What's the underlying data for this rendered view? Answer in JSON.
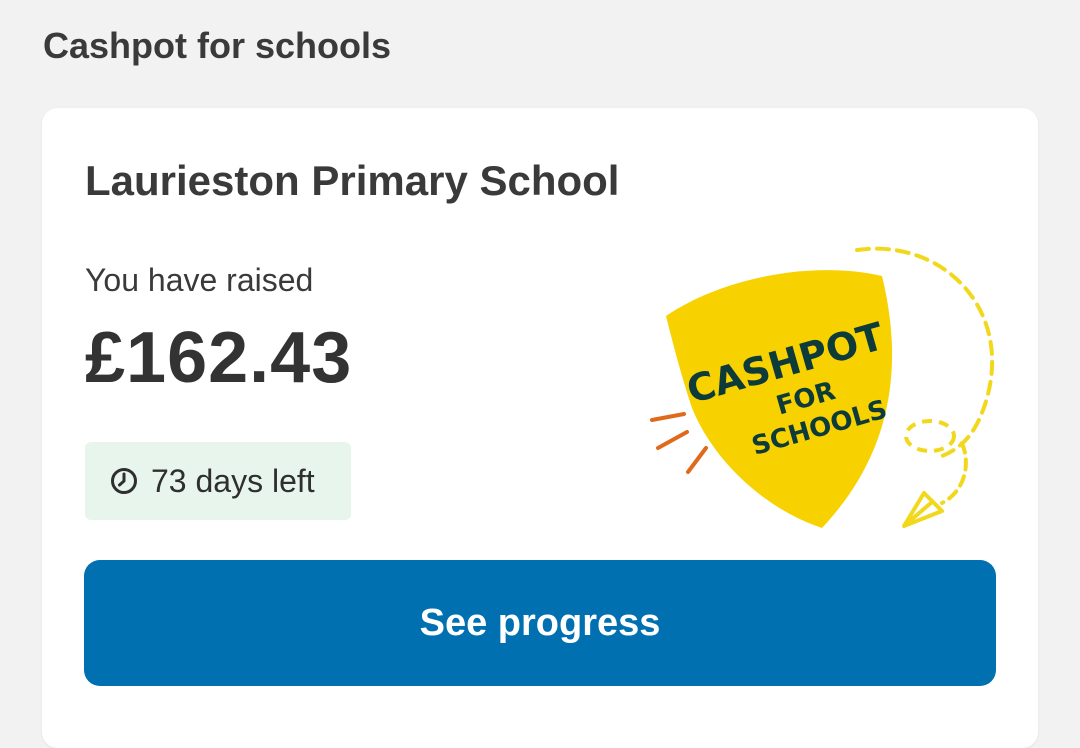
{
  "section": {
    "title": "Cashpot for schools"
  },
  "card": {
    "school_name": "Laurieston Primary School",
    "raised_label": "You have raised",
    "raised_amount": "£162.43",
    "days_left": "73 days left",
    "button_label": "See progress"
  },
  "logo": {
    "line1": "CASHPOT",
    "line2": "FOR",
    "line3": "SCHOOLS"
  },
  "icons": {
    "clock": "clock-icon",
    "badge": "cashpot-logo"
  },
  "colors": {
    "background": "#f2f2f2",
    "card": "#ffffff",
    "button": "#0070b0",
    "badge_bg": "#e8f5ec",
    "logo_yellow": "#f7d100",
    "logo_text": "#0d3b3a",
    "accent_orange": "#e06a1b"
  }
}
